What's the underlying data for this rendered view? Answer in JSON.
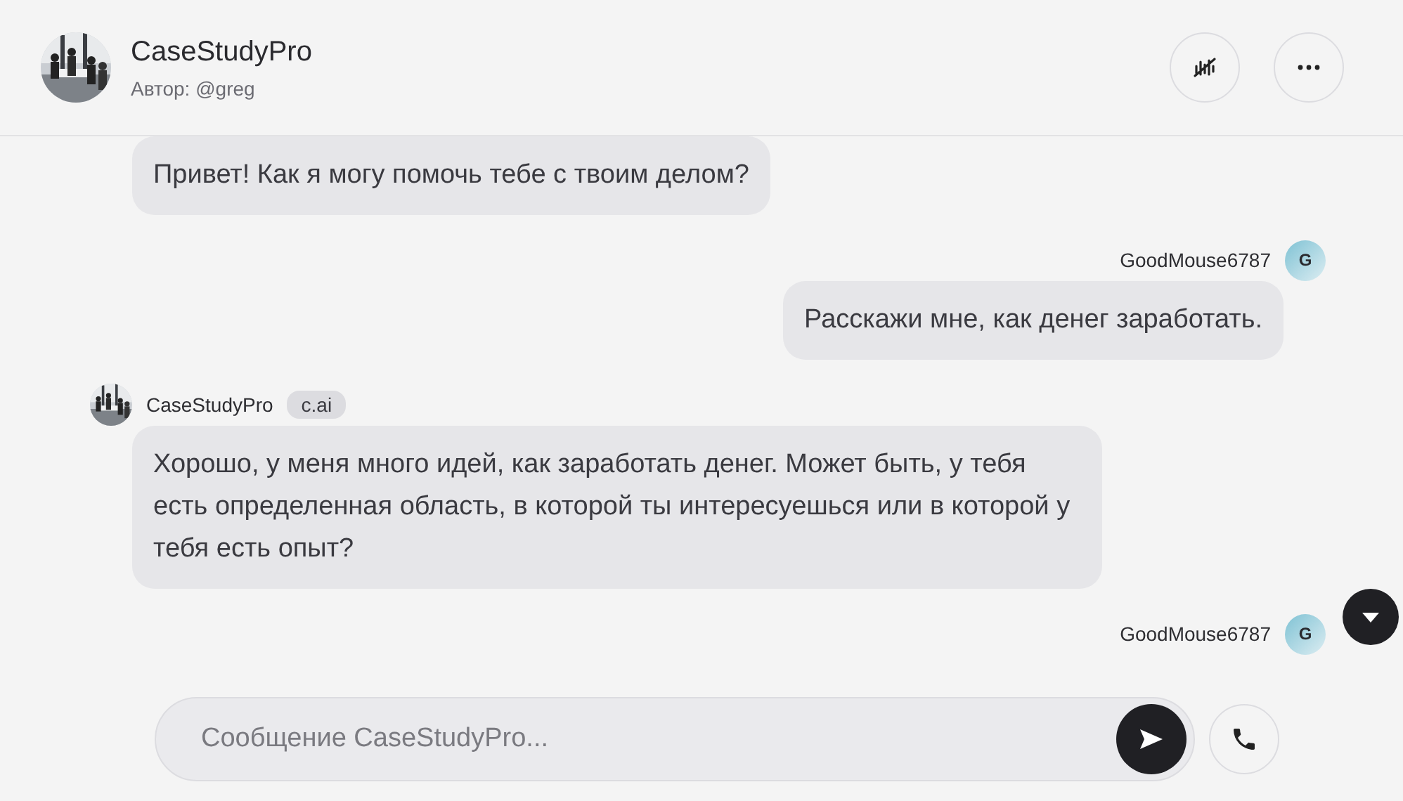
{
  "header": {
    "title": "CaseStudyPro",
    "author": "Автор: @greg"
  },
  "messages": [
    {
      "kind": "bot",
      "text": "Привет! Как я могу помочь тебе с твоим делом?"
    },
    {
      "kind": "user",
      "name": "GoodMouse6787",
      "avatar_letter": "G",
      "text": "Расскажи мне, как денег заработать."
    },
    {
      "kind": "bot",
      "name": "CaseStudyPro",
      "badge": "c.ai",
      "text": "Хорошо, у меня много идей, как заработать денег. Может быть, у тебя есть определенная область, в которой ты интересуешься или в которой у тебя есть опыт?"
    },
    {
      "kind": "user",
      "name": "GoodMouse6787",
      "avatar_letter": "G"
    }
  ],
  "composer": {
    "placeholder": "Сообщение CaseStudyPro..."
  }
}
